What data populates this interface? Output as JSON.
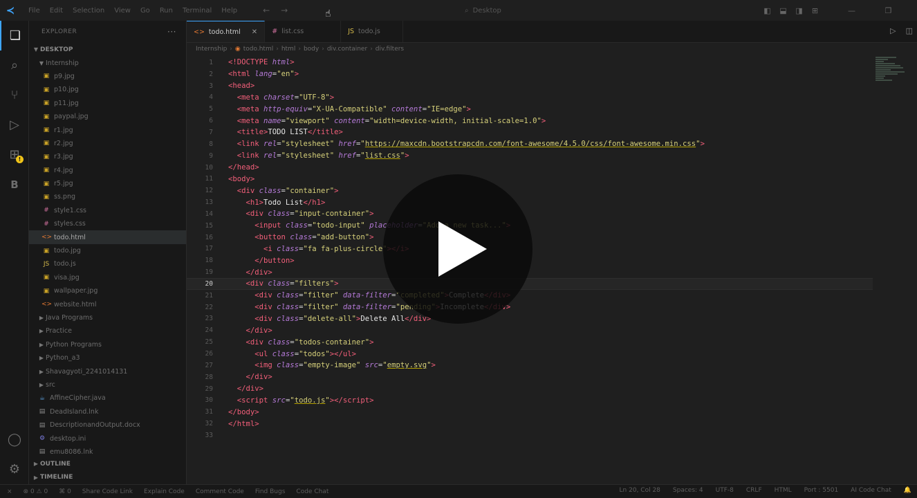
{
  "titlebar": {
    "menu": [
      "File",
      "Edit",
      "Selection",
      "View",
      "Go",
      "Run",
      "Terminal",
      "Help"
    ],
    "search": "Desktop"
  },
  "sidebar": {
    "title": "EXPLORER",
    "root": "DESKTOP",
    "folder_open": "Internship",
    "files": [
      {
        "name": "p9.jpg",
        "type": "img"
      },
      {
        "name": "p10.jpg",
        "type": "img"
      },
      {
        "name": "p11.jpg",
        "type": "img"
      },
      {
        "name": "paypal.jpg",
        "type": "img"
      },
      {
        "name": "r1.jpg",
        "type": "img"
      },
      {
        "name": "r2.jpg",
        "type": "img"
      },
      {
        "name": "r3.jpg",
        "type": "img"
      },
      {
        "name": "r4.jpg",
        "type": "img"
      },
      {
        "name": "r5.jpg",
        "type": "img"
      },
      {
        "name": "ss.png",
        "type": "img"
      },
      {
        "name": "style1.css",
        "type": "css"
      },
      {
        "name": "styles.css",
        "type": "css"
      },
      {
        "name": "todo.html",
        "type": "html"
      },
      {
        "name": "todo.jpg",
        "type": "img"
      },
      {
        "name": "todo.js",
        "type": "js"
      },
      {
        "name": "visa.jpg",
        "type": "img"
      },
      {
        "name": "wallpaper.jpg",
        "type": "img"
      },
      {
        "name": "website.html",
        "type": "html"
      }
    ],
    "folders": [
      "Java Programs",
      "Practice",
      "Python Programs",
      "Python_a3",
      "Shavagyoti_2241014131",
      "src"
    ],
    "root_files": [
      {
        "name": "AffineCipher.java",
        "type": "java"
      },
      {
        "name": "DeadIsland.lnk",
        "type": "file"
      },
      {
        "name": "DescriptionandOutput.docx",
        "type": "file"
      },
      {
        "name": "desktop.ini",
        "type": "ini"
      },
      {
        "name": "emu8086.lnk",
        "type": "file"
      }
    ],
    "outline": "OUTLINE",
    "timeline": "TIMELINE"
  },
  "editor": {
    "tabs": [
      {
        "label": "todo.html",
        "icon": "<>",
        "active": true
      },
      {
        "label": "list.css",
        "icon": "#",
        "active": false
      },
      {
        "label": "todo.js",
        "icon": "JS",
        "active": false
      }
    ],
    "breadcrumb": [
      "Internship",
      "todo.html",
      "html",
      "body",
      "div.container",
      "div.filters"
    ],
    "current_line": 20,
    "line_count": 33
  },
  "statusbar": {
    "left": [
      "⊗ 0 ⚠ 0",
      "⌘ 0",
      "Share Code Link",
      "Explain Code",
      "Comment Code",
      "Find Bugs",
      "Code Chat"
    ],
    "right": [
      "Ln 20, Col 28",
      "Spaces: 4",
      "UTF-8",
      "CRLF",
      "HTML",
      "Port : 5501",
      "AI Code Chat"
    ]
  }
}
